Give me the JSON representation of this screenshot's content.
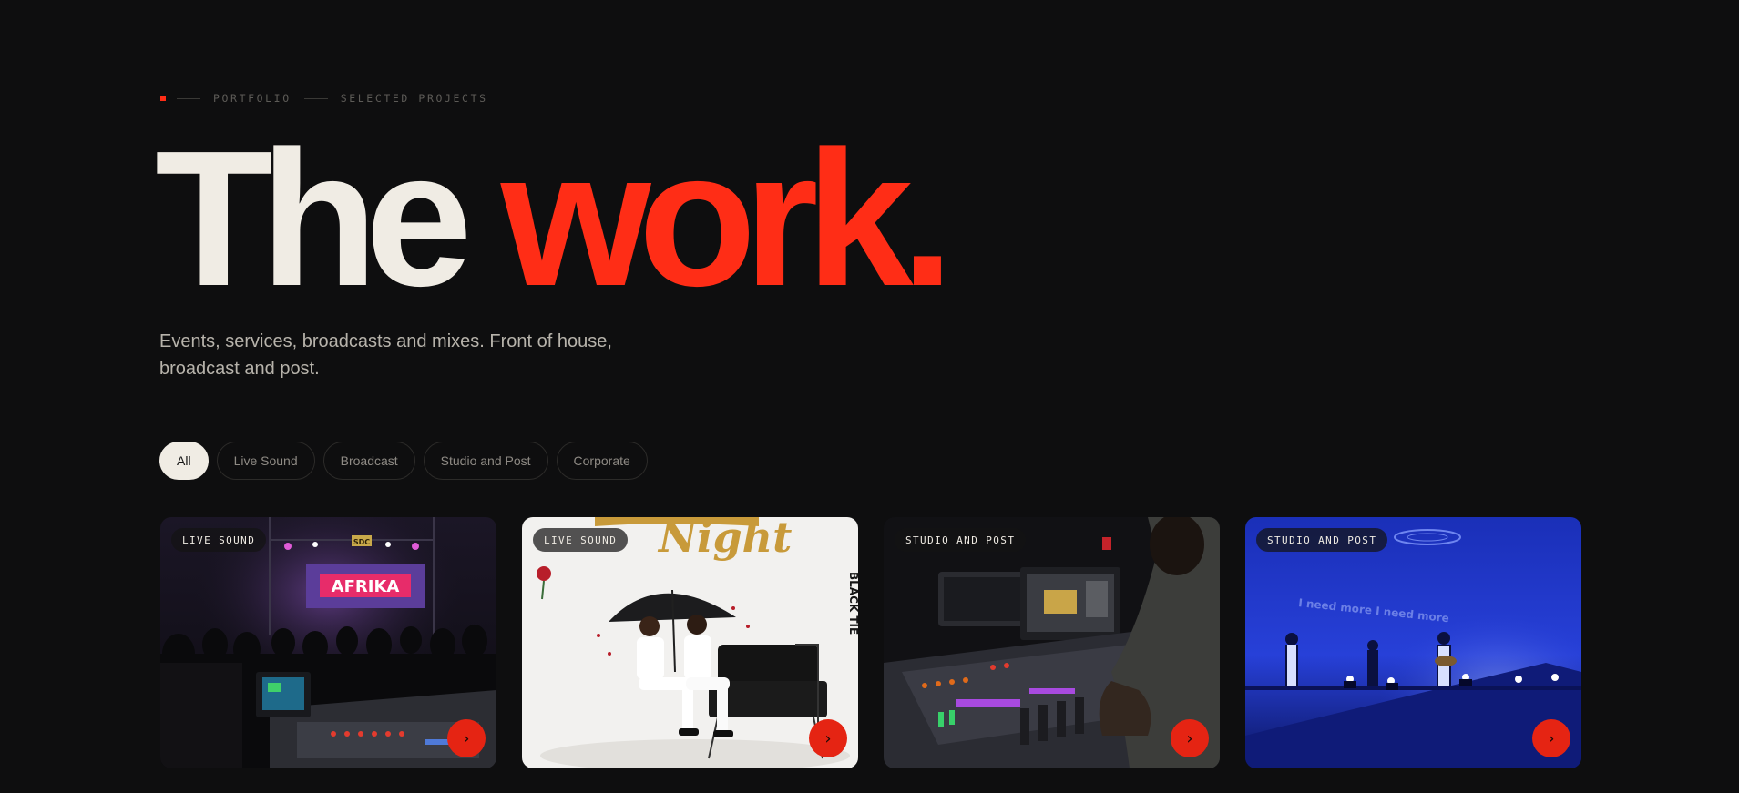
{
  "eyebrow": {
    "section": "PORTFOLIO",
    "subsection": "SELECTED PROJECTS"
  },
  "hero": {
    "headline_part1": "The",
    "headline_part2": "work.",
    "intro": "Events, services, broadcasts and mixes. Front of house, broadcast and post."
  },
  "filters": [
    {
      "label": "All",
      "active": true
    },
    {
      "label": "Live Sound",
      "active": false
    },
    {
      "label": "Broadcast",
      "active": false
    },
    {
      "label": "Studio and Post",
      "active": false
    },
    {
      "label": "Corporate",
      "active": false
    }
  ],
  "projects": [
    {
      "category": "LIVE SOUND",
      "image": "concert-crowd-mixing-desk",
      "banner_text": "AFRIKA",
      "screen_logo": "SDC"
    },
    {
      "category": "LIVE SOUND",
      "image": "black-tie-night-poster",
      "poster_script": "Night",
      "poster_side_text": "BLACK TIE"
    },
    {
      "category": "STUDIO AND POST",
      "image": "studio-mixing-console"
    },
    {
      "category": "STUDIO AND POST",
      "image": "stage-blue-lights",
      "screen_text": "I need more I need more"
    }
  ],
  "colors": {
    "background": "#0e0e0f",
    "accent": "#ff2d16",
    "text": "#f0ece4"
  },
  "icons": {
    "card_arrow": "chevron-right-icon"
  }
}
